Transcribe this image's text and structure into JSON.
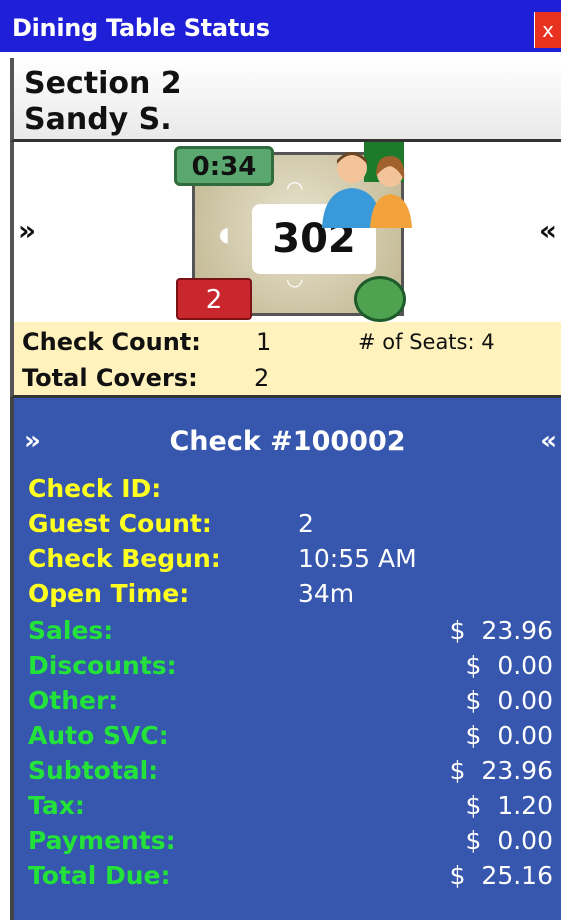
{
  "window": {
    "title": "Dining Table Status",
    "close_label": "x"
  },
  "section": {
    "name": "Section 2",
    "server": "Sandy S."
  },
  "table": {
    "elapsed": "0:34",
    "number": "302",
    "badge_number": "2",
    "nav_left": "»",
    "nav_right": "«",
    "status_color": "#4fa24f"
  },
  "summary": {
    "check_count_label": "Check Count:",
    "check_count_value": "1",
    "seats_text": "# of Seats: 4",
    "total_covers_label": "Total Covers:",
    "total_covers_value": "2"
  },
  "check": {
    "nav_left": "»",
    "nav_right": "«",
    "title": "Check #100002",
    "info": [
      {
        "label": "Check ID:",
        "value": ""
      },
      {
        "label": "Guest Count:",
        "value": "2"
      },
      {
        "label": "Check Begun:",
        "value": "10:55 AM"
      },
      {
        "label": "Open Time:",
        "value": "34m"
      }
    ],
    "totals": [
      {
        "label": "Sales:",
        "value": "$  23.96"
      },
      {
        "label": "Discounts:",
        "value": "$  0.00"
      },
      {
        "label": "Other:",
        "value": "$  0.00"
      },
      {
        "label": "Auto SVC:",
        "value": "$  0.00"
      },
      {
        "label": "Subtotal:",
        "value": "$  23.96"
      },
      {
        "label": "Tax:",
        "value": "$  1.20"
      },
      {
        "label": "Payments:",
        "value": "$  0.00"
      },
      {
        "label": "Total Due:",
        "value": "$  25.16"
      }
    ]
  },
  "colors": {
    "titlebar": "#1f1fd8",
    "panel": "#3657ad",
    "info_label": "#ffff20",
    "totals_label": "#23e23a",
    "summary_bg": "#fff2bc"
  }
}
